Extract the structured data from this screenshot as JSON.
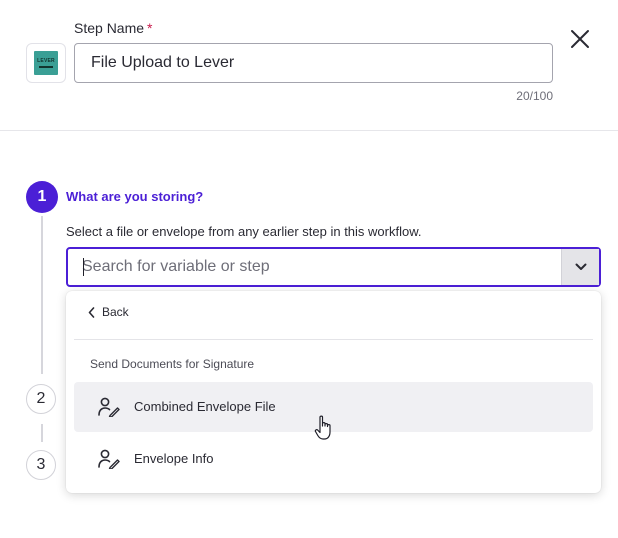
{
  "header": {
    "step_name_label": "Step Name",
    "required_marker": "*",
    "step_name_value": "File Upload to Lever",
    "char_count": "20/100",
    "logo_text": "LEVER",
    "logo_icon": "lever-logo"
  },
  "steps": [
    {
      "number": "1",
      "active": true,
      "title": "What are you storing?",
      "help_text": "Select a file or envelope from any earlier step in this workflow."
    },
    {
      "number": "2",
      "active": false
    },
    {
      "number": "3",
      "active": false
    }
  ],
  "search": {
    "placeholder": "Search for variable or step",
    "value": "",
    "toggle_icon": "chevron-down-icon"
  },
  "menu": {
    "back_label": "Back",
    "group_label": "Send Documents for Signature",
    "items": [
      {
        "label": "Combined Envelope File",
        "icon": "user-sign-icon",
        "hovered": true
      },
      {
        "label": "Envelope Info",
        "icon": "user-sign-icon",
        "hovered": false
      }
    ]
  },
  "colors": {
    "accent": "#4b1fd6",
    "required": "#c8194b",
    "hover_bg": "#f0f0f3",
    "logo_bg": "#3a9f95"
  }
}
